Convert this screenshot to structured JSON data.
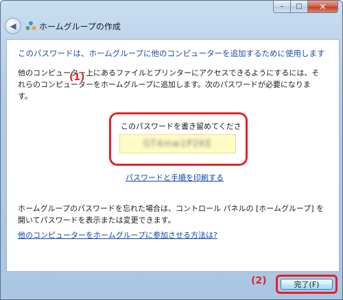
{
  "window": {
    "title": "ホームグループの作成",
    "controls": {
      "minimize": "–",
      "maximize": "□",
      "close": "✕"
    }
  },
  "content": {
    "heading": "このパスワードは、ホームグループに他のコンピューターを追加するために使用します",
    "description": "他のコンピューター上にあるファイルとプリンターにアクセスできるようにするには、それらのコンピューターをホームグループに追加します。次のパスワードが必要になります。",
    "password_label": "このパスワードを書き留めてください:",
    "password_value": "GT4mw1P2KE",
    "print_link": "パスワードと手順を印刷する",
    "forgot_text": "ホームグループのパスワードを忘れた場合は、コントロール パネルの [ホームグループ] を開いてパスワードを表示または変更できます。",
    "join_link": "他のコンピューターをホームグループに参加させる方法は?"
  },
  "annotations": {
    "first": "(1)",
    "second": "(2)"
  },
  "footer": {
    "finish_label": "完了(F)"
  },
  "colors": {
    "annotation_red": "#e4202a",
    "heading_blue": "#1e4e9b",
    "link_blue": "#0645ad",
    "password_bg": "#fefbc5"
  }
}
